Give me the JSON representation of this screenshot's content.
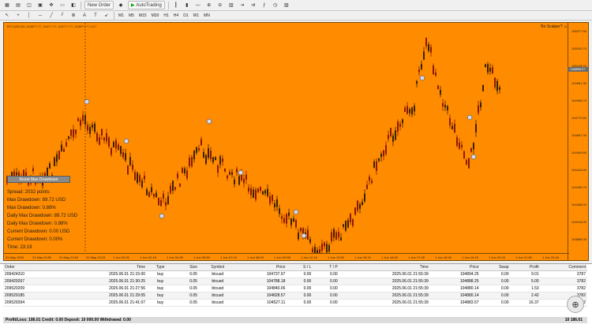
{
  "toolbar": {
    "new_order_label": "New Order",
    "autotrading_label": "AutoTrading",
    "timeframes": [
      "M1",
      "M5",
      "M15",
      "M30",
      "H1",
      "H4",
      "D1",
      "W1",
      "MN"
    ]
  },
  "chart": {
    "title": "BTCUSD,M1 1048??.??, 104??.??, 104???.??, 1048??.?? 1/1?",
    "ea_name": "Bo Scalper? ☺",
    "current_price": "104898.27",
    "price_ticks": [
      "105377.90",
      "105310.70",
      "105148.00",
      "104961.30",
      "104908.70",
      "104772.60",
      "104697.00",
      "104545.60",
      "104415.90",
      "104296.70",
      "104168.00",
      "104015.00",
      "103896.30"
    ],
    "time_ticks": [
      "31 May 2025",
      "31 May 20:52",
      "31 May 22:52",
      "31 May 23:23",
      "1 Jun 00:20",
      "1 Jun 02:18",
      "1 Jun 04:05",
      "1 Jun 05:50",
      "1 Jun 07:19",
      "1 Jun 08:03",
      "1 Jun 09:55",
      "1 Jun 12:15",
      "1 Jun 13:50",
      "1 Jun 15:10",
      "1 Jun 16:05",
      "1 Jun 17:28",
      "1 Jun 18:34",
      "1 Jun 19:15",
      "1 Jun 20:15",
      "1 Jun 21:50",
      "1 Jun 23:18"
    ]
  },
  "panel": {
    "reset_label": "Reset Max Drawdown",
    "stats": [
      "Spread: 2032 points",
      "Max Drawdown: 89.72 USD",
      "Max Drawdown: 0.88%",
      "Daily Max Drawdown: 89.72 USD",
      "Daily Max Drawdown: 0.88%",
      "Current Drawdown: 0.00 USD",
      "Current Drawdown: 0.00%",
      "Time: 23:19"
    ]
  },
  "trade": {
    "columns": [
      "Order",
      "Time",
      "Type",
      "Size",
      "Symbol",
      "Price",
      "S / L",
      "T / P",
      "Time",
      "Price",
      "Swap",
      "Profit",
      "Comment"
    ],
    "rows": [
      [
        "209424310",
        "2025.06.01 21:15:00",
        "buy",
        "0.05",
        "btcusd",
        "104737.97",
        "0.00",
        "0.00",
        "2025.06.01 21:55:39",
        "104894.25",
        "0.00",
        "9.01",
        "3787"
      ],
      [
        "209429267",
        "2025.06.01 21:30:25",
        "buy",
        "0.05",
        "btcusd",
        "104788.18",
        "0.00",
        "0.00",
        "2025.06.01 21:55:39",
        "104888.25",
        "0.00",
        "5.00",
        "3782"
      ],
      [
        "209520209",
        "2025.06.01 21:27:56",
        "buy",
        "0.05",
        "btcusd",
        "104840.06",
        "0.00",
        "0.00",
        "2025.06.01 21:55:39",
        "104880.14",
        "0.00",
        "1.53",
        "3782"
      ],
      [
        "209529185",
        "2025.06.01 21:29:05",
        "buy",
        "0.05",
        "btcusd",
        "104828.57",
        "0.00",
        "0.00",
        "2025.06.01 21:55:39",
        "104880.14",
        "0.00",
        "2.42",
        "3782"
      ],
      [
        "209529394",
        "2025.06.01 21:41:07",
        "buy",
        "0.05",
        "btcusd",
        "104527.11",
        "0.00",
        "0.00",
        "2025.06.01 21:55:39",
        "104883.57",
        "0.00",
        "16.37",
        "3782"
      ]
    ],
    "footer_label": "Profit/Loss: 186.01  Credit: 0.00  Deposit: 10 000.00  Withdrawal: 0.00",
    "footer_total": "10 186.01"
  },
  "colors": {
    "chart_bg": "#ff8c00",
    "bull": "#3a2000",
    "bear": "#8b1a00"
  }
}
